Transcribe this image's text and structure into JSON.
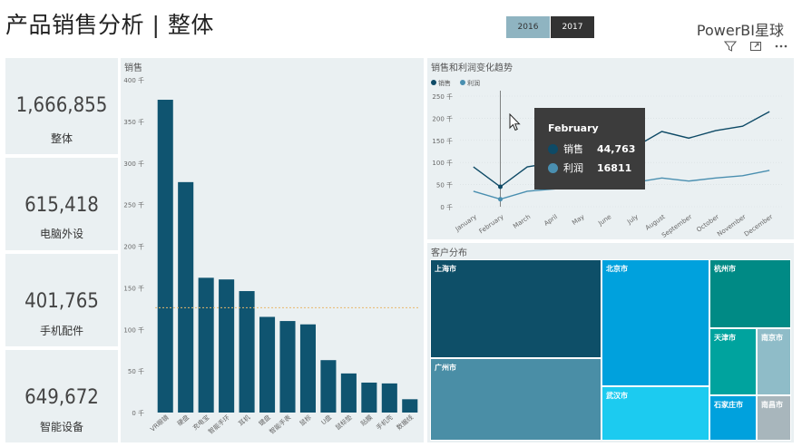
{
  "header": {
    "title": "产品销售分析 | 整体",
    "brand": "PowerBI星球",
    "year_buttons": [
      {
        "label": "2016",
        "selected": false,
        "color": "#8fb4c1"
      },
      {
        "label": "2017",
        "selected": true,
        "color": "#333333"
      }
    ],
    "icons": [
      "filter-icon",
      "focus-mode-icon",
      "more-options-icon"
    ]
  },
  "kpis": [
    {
      "value": "1,666,855",
      "label": "整体"
    },
    {
      "value": "615,418",
      "label": "电脑外设"
    },
    {
      "value": "401,765",
      "label": "手机配件"
    },
    {
      "value": "649,672",
      "label": "智能设备"
    }
  ],
  "chart_data": [
    {
      "type": "bar",
      "title": "销售",
      "categories": [
        "VR眼镜",
        "硬盘",
        "充电宝",
        "智能手环",
        "耳机",
        "键盘",
        "智能手表",
        "鼠标",
        "U盘",
        "鼠标垫",
        "贴膜",
        "手机壳",
        "数据线"
      ],
      "values": [
        376,
        277,
        162,
        160,
        146,
        115,
        110,
        106,
        63,
        47,
        36,
        35,
        16
      ],
      "average_line": 126,
      "y_ticks": [
        "0 千",
        "50 千",
        "100 千",
        "150 千",
        "200 千",
        "250 千",
        "300 千",
        "350 千",
        "400 千"
      ],
      "ylim": [
        0,
        400
      ],
      "unit": "千",
      "color": "#0f5470",
      "avg_color": "#e8b86d"
    },
    {
      "type": "line",
      "title": "销售和利润变化趋势",
      "x": [
        "January",
        "February",
        "March",
        "April",
        "May",
        "June",
        "July",
        "August",
        "September",
        "October",
        "November",
        "December"
      ],
      "series": [
        {
          "name": "销售",
          "values": [
            90,
            45,
            90,
            100,
            110,
            120,
            135,
            170,
            155,
            172,
            182,
            215
          ],
          "color": "#0e4a66"
        },
        {
          "name": "利润",
          "values": [
            35,
            17,
            35,
            40,
            45,
            50,
            55,
            65,
            58,
            65,
            70,
            82
          ],
          "color": "#4a8fb0"
        }
      ],
      "y_ticks": [
        "0 千",
        "50 千",
        "100 千",
        "150 千",
        "200 千",
        "250 千"
      ],
      "ylim": [
        0,
        250
      ],
      "legend": "top-left"
    }
  ],
  "tooltip": {
    "month": "February",
    "rows": [
      {
        "name": "销售",
        "value": "44,763",
        "color": "#0e4a66"
      },
      {
        "name": "利润",
        "value": "16811",
        "color": "#4a8fb0"
      }
    ]
  },
  "treemap": {
    "title": "客户分布",
    "cells": [
      {
        "name": "上海市",
        "color": "#0e4f68"
      },
      {
        "name": "广州市",
        "color": "#4a8ea6"
      },
      {
        "name": "北京市",
        "color": "#00a1dd"
      },
      {
        "name": "武汉市",
        "color": "#1ccbf0"
      },
      {
        "name": "杭州市",
        "color": "#008a85"
      },
      {
        "name": "天津市",
        "color": "#00a39e"
      },
      {
        "name": "南京市",
        "color": "#8fbcc8"
      },
      {
        "name": "石家庄市",
        "color": "#00a1dd"
      },
      {
        "name": "南昌市",
        "color": "#a8b6bc"
      }
    ]
  }
}
